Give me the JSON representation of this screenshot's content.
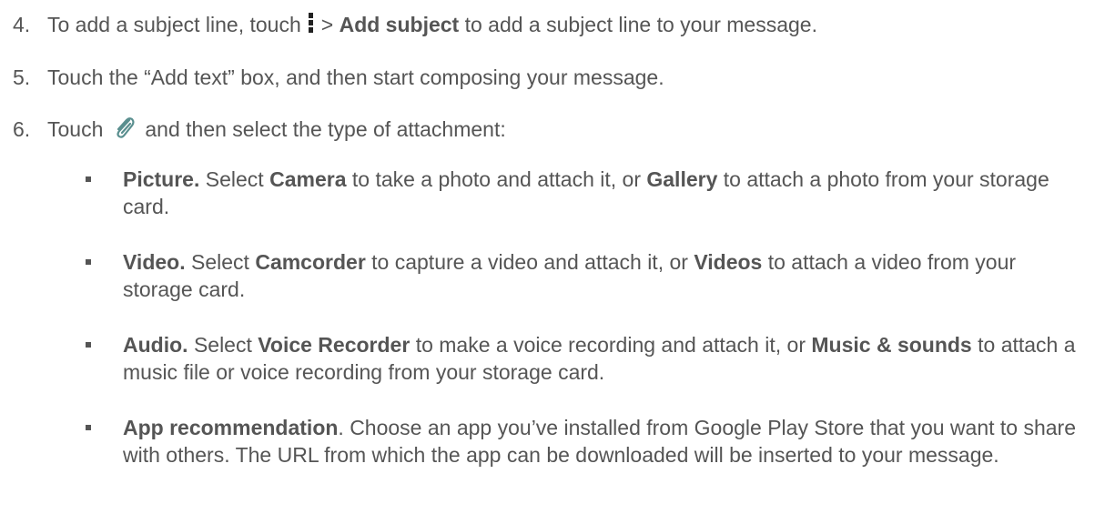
{
  "steps": [
    {
      "num": "4.",
      "parts": [
        "To add a subject line, touch",
        ">",
        "Add subject",
        "to add a subject line to your message."
      ],
      "icon": "more-options-icon"
    },
    {
      "num": "5.",
      "text": "Touch the “Add text” box, and then start composing your message."
    },
    {
      "num": "6.",
      "parts": [
        "Touch",
        "and then select the type of attachment:"
      ],
      "icon": "paperclip-icon"
    }
  ],
  "bullets": [
    {
      "lead": "Picture.",
      "t1": "Select",
      "b1": "Camera",
      "t2": "to take a photo and attach it, or",
      "b2": "Gallery",
      "t3": "to attach a photo from your storage card."
    },
    {
      "lead": "Video.",
      "t1": "Select",
      "b1": "Camcorder",
      "t2": "to capture a video and attach it, or",
      "b2": "Videos",
      "t3": "to attach a video from your storage card."
    },
    {
      "lead": "Audio.",
      "t1": "Select",
      "b1": "Voice Recorder",
      "t2": "to make a voice recording and attach it, or",
      "b2": "Music & sounds",
      "t3": "to attach a music file or voice recording from your storage card."
    },
    {
      "lead": "App recommendation",
      "t1": ". Choose an app you’ve installed from Google Play Store that you want to share with others. The URL from which the app can be downloaded will be inserted to your message."
    }
  ],
  "colors": {
    "text": "#555555",
    "icon": "#222222"
  }
}
